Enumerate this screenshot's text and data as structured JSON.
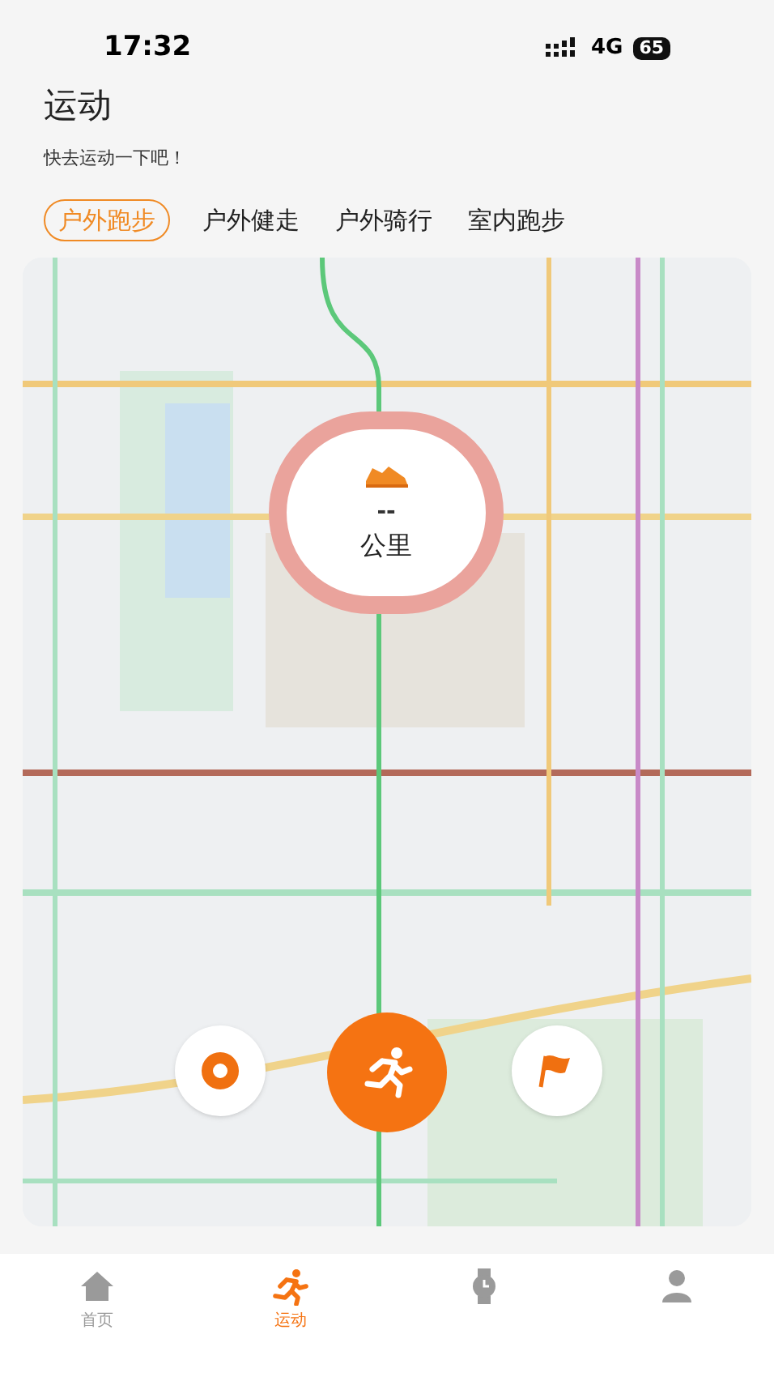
{
  "status_bar": {
    "time": "17:32",
    "network": "4G",
    "battery": "65"
  },
  "header": {
    "title": "运动",
    "subtitle": "快去运动一下吧！"
  },
  "tabs": [
    {
      "label": "户外跑步",
      "selected": true
    },
    {
      "label": "户外健走",
      "selected": false
    },
    {
      "label": "户外骑行",
      "selected": false
    },
    {
      "label": "室内跑步",
      "selected": false
    }
  ],
  "distance": {
    "value": "--",
    "unit": "公里"
  },
  "bottom_nav": [
    {
      "kind": "home",
      "label": "首页",
      "selected": false
    },
    {
      "kind": "run",
      "label": "运动",
      "selected": true
    },
    {
      "kind": "watch",
      "selected": false
    },
    {
      "kind": "person",
      "selected": false
    }
  ]
}
